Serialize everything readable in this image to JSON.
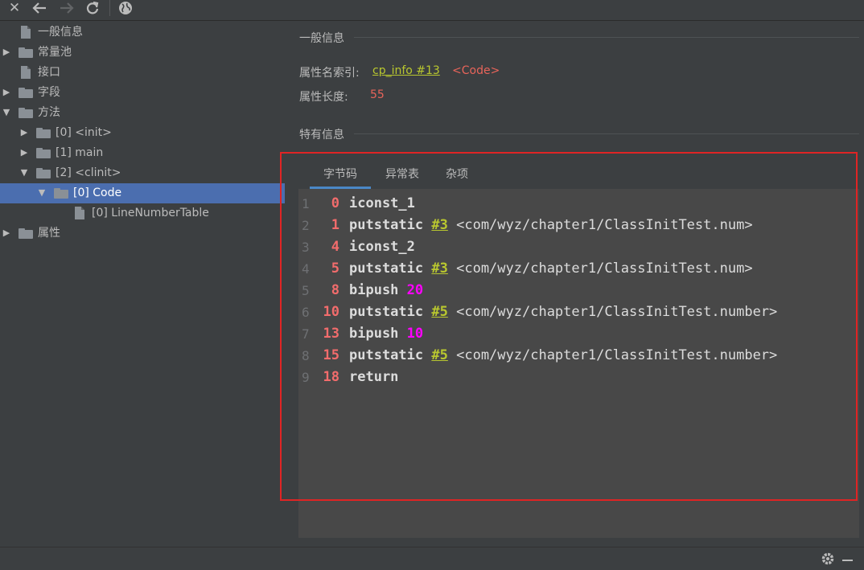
{
  "toolbar": {
    "close_icon": "close-icon",
    "back_icon": "back-arrow-icon",
    "forward_icon": "forward-arrow-icon",
    "refresh_icon": "refresh-icon",
    "web_icon": "globe-icon"
  },
  "tree": {
    "items": [
      {
        "label": "一般信息",
        "kind": "file"
      },
      {
        "label": "常量池",
        "kind": "folder"
      },
      {
        "label": "接口",
        "kind": "file"
      },
      {
        "label": "字段",
        "kind": "folder"
      },
      {
        "label": "方法",
        "kind": "folder"
      },
      {
        "label": "[0] <init>",
        "kind": "folder"
      },
      {
        "label": "[1] main",
        "kind": "folder"
      },
      {
        "label": "[2] <clinit>",
        "kind": "folder"
      },
      {
        "label": "[0] Code",
        "kind": "folder"
      },
      {
        "label": "[0] LineNumberTable",
        "kind": "file"
      },
      {
        "label": "属性",
        "kind": "folder"
      }
    ]
  },
  "general": {
    "title": "一般信息",
    "attr_name_label": "属性名索引:",
    "attr_name_link": "cp_info #13",
    "attr_name_value": "<Code>",
    "attr_len_label": "属性长度:",
    "attr_len_value": "55"
  },
  "specific": {
    "title": "特有信息",
    "tabs": [
      "字节码",
      "异常表",
      "杂项"
    ],
    "active_tab": "字节码"
  },
  "code": {
    "lines": [
      {
        "ln": "1",
        "offset": "0",
        "op": "iconst_1"
      },
      {
        "ln": "2",
        "offset": "1",
        "op": "putstatic",
        "ref": "#3",
        "cls": "<com/wyz/chapter1/ClassInitTest.num>"
      },
      {
        "ln": "3",
        "offset": "4",
        "op": "iconst_2"
      },
      {
        "ln": "4",
        "offset": "5",
        "op": "putstatic",
        "ref": "#3",
        "cls": "<com/wyz/chapter1/ClassInitTest.num>"
      },
      {
        "ln": "5",
        "offset": "8",
        "op": "bipush",
        "num": "20"
      },
      {
        "ln": "6",
        "offset": "10",
        "op": "putstatic",
        "ref": "#5",
        "cls": "<com/wyz/chapter1/ClassInitTest.number>"
      },
      {
        "ln": "7",
        "offset": "13",
        "op": "bipush",
        "num": "10"
      },
      {
        "ln": "8",
        "offset": "15",
        "op": "putstatic",
        "ref": "#5",
        "cls": "<com/wyz/chapter1/ClassInitTest.number>"
      },
      {
        "ln": "9",
        "offset": "18",
        "op": "return"
      }
    ]
  },
  "status": {
    "gear_icon": "gear-icon",
    "minimize_icon": "minimize-icon"
  },
  "colors": {
    "background": "#3c3f41",
    "selection": "#4b6eaf",
    "link": "#b9c72f",
    "value": "#e8645a",
    "number": "#ff00ff",
    "highlight_box": "#e02424"
  }
}
